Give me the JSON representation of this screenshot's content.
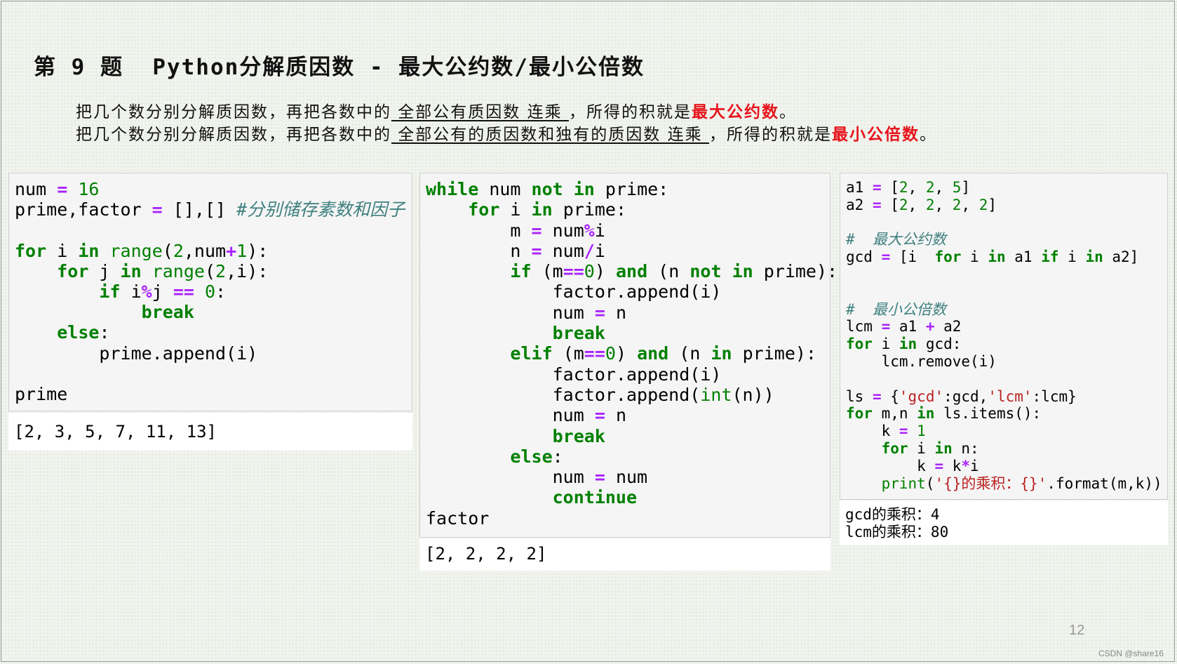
{
  "title": "第 9 题  Python分解质因数 - 最大公约数/最小公倍数",
  "desc1": {
    "pre": "把几个数分别分解质因数，再把各数中的",
    "ul": " 全部公有质因数 连乘 ",
    "mid": "，所得的积就是",
    "red": "最大公约数",
    "end": "。"
  },
  "desc2": {
    "pre": "把几个数分别分解质因数，再把各数中的",
    "ul": " 全部公有的质因数和独有的质因数 连乘 ",
    "mid": "，所得的积就是",
    "red": "最小公倍数",
    "end": "。"
  },
  "cell1": {
    "code_lines": [
      "num = 16",
      "prime,factor = [],[] #分别储存素数和因子",
      "",
      "for i in range(2,num+1):",
      "    for j in range(2,i):",
      "        if i%j == 0:",
      "            break",
      "    else:",
      "        prime.append(i)",
      "",
      "prime"
    ],
    "output": "[2, 3, 5, 7, 11, 13]"
  },
  "cell2": {
    "code_lines": [
      "while num not in prime:",
      "    for i in prime:",
      "        m = num%i",
      "        n = num/i",
      "        if (m==0) and (n not in prime):",
      "            factor.append(i)",
      "            num = n",
      "            break",
      "        elif (m==0) and (n in prime):",
      "            factor.append(i)",
      "            factor.append(int(n))",
      "            num = n",
      "            break",
      "        else:",
      "            num = num",
      "            continue",
      "factor"
    ],
    "output": "[2, 2, 2, 2]"
  },
  "cell3": {
    "code_lines": [
      "a1 = [2, 2, 5]",
      "a2 = [2, 2, 2, 2]",
      "",
      "#  最大公约数",
      "gcd = [i  for i in a1 if i in a2]",
      "",
      "",
      "#  最小公倍数",
      "lcm = a1 + a2",
      "for i in gcd:",
      "    lcm.remove(i)",
      "",
      "ls = {'gcd':gcd,'lcm':lcm}",
      "for m,n in ls.items():",
      "    k = 1",
      "    for i in n:",
      "        k = k*i",
      "    print('{}的乘积：{}'.format(m,k))"
    ],
    "output_lines": [
      "gcd的乘积：4",
      "lcm的乘积：80"
    ]
  },
  "page_number": "12",
  "watermark": "CSDN @share16"
}
